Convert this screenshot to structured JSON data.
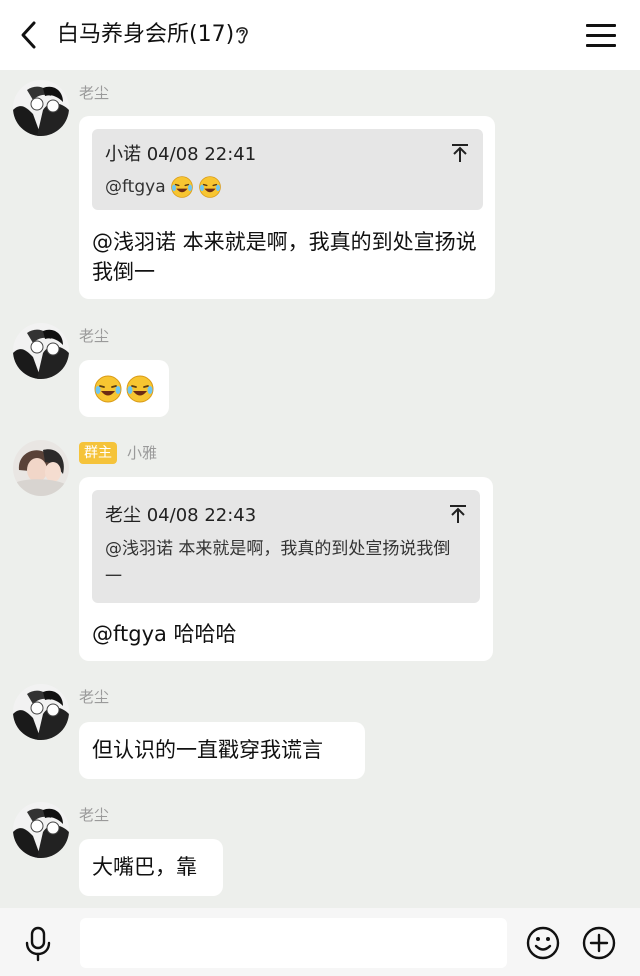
{
  "header": {
    "back_icon": "chevron-left-icon",
    "title": "白马养身会所(17)",
    "ear_icon": "ear-icon",
    "menu_icon": "hamburger-menu-icon"
  },
  "messages": [
    {
      "sender": "老尘",
      "quote": {
        "head": "小诺 04/08 22:41",
        "body": "@ftgya",
        "emoji_count": 2
      },
      "text": "@浅羽诺 本来就是啊，我真的到处宣扬说我倒一"
    },
    {
      "sender": "老尘",
      "emoji_count": 2
    },
    {
      "sender": "小雅",
      "badge": "群主",
      "quote": {
        "head": "老尘 04/08 22:43",
        "body": "@浅羽诺 本来就是啊，我真的到处宣扬说我倒一"
      },
      "text": "@ftgya 哈哈哈"
    },
    {
      "sender": "老尘",
      "text": "但认识的一直戳穿我谎言"
    },
    {
      "sender": "老尘",
      "text": "大嘴巴，靠"
    }
  ],
  "inputbar": {
    "mic_icon": "microphone-icon",
    "input_value": "",
    "emoji_icon": "smiley-icon",
    "plus_icon": "plus-circle-icon"
  },
  "colors": {
    "background": "#edefec",
    "bubble": "#ffffff",
    "quote_bg": "#e6e6e6",
    "badge": "#f5c33a",
    "name": "#9a9a9a"
  }
}
